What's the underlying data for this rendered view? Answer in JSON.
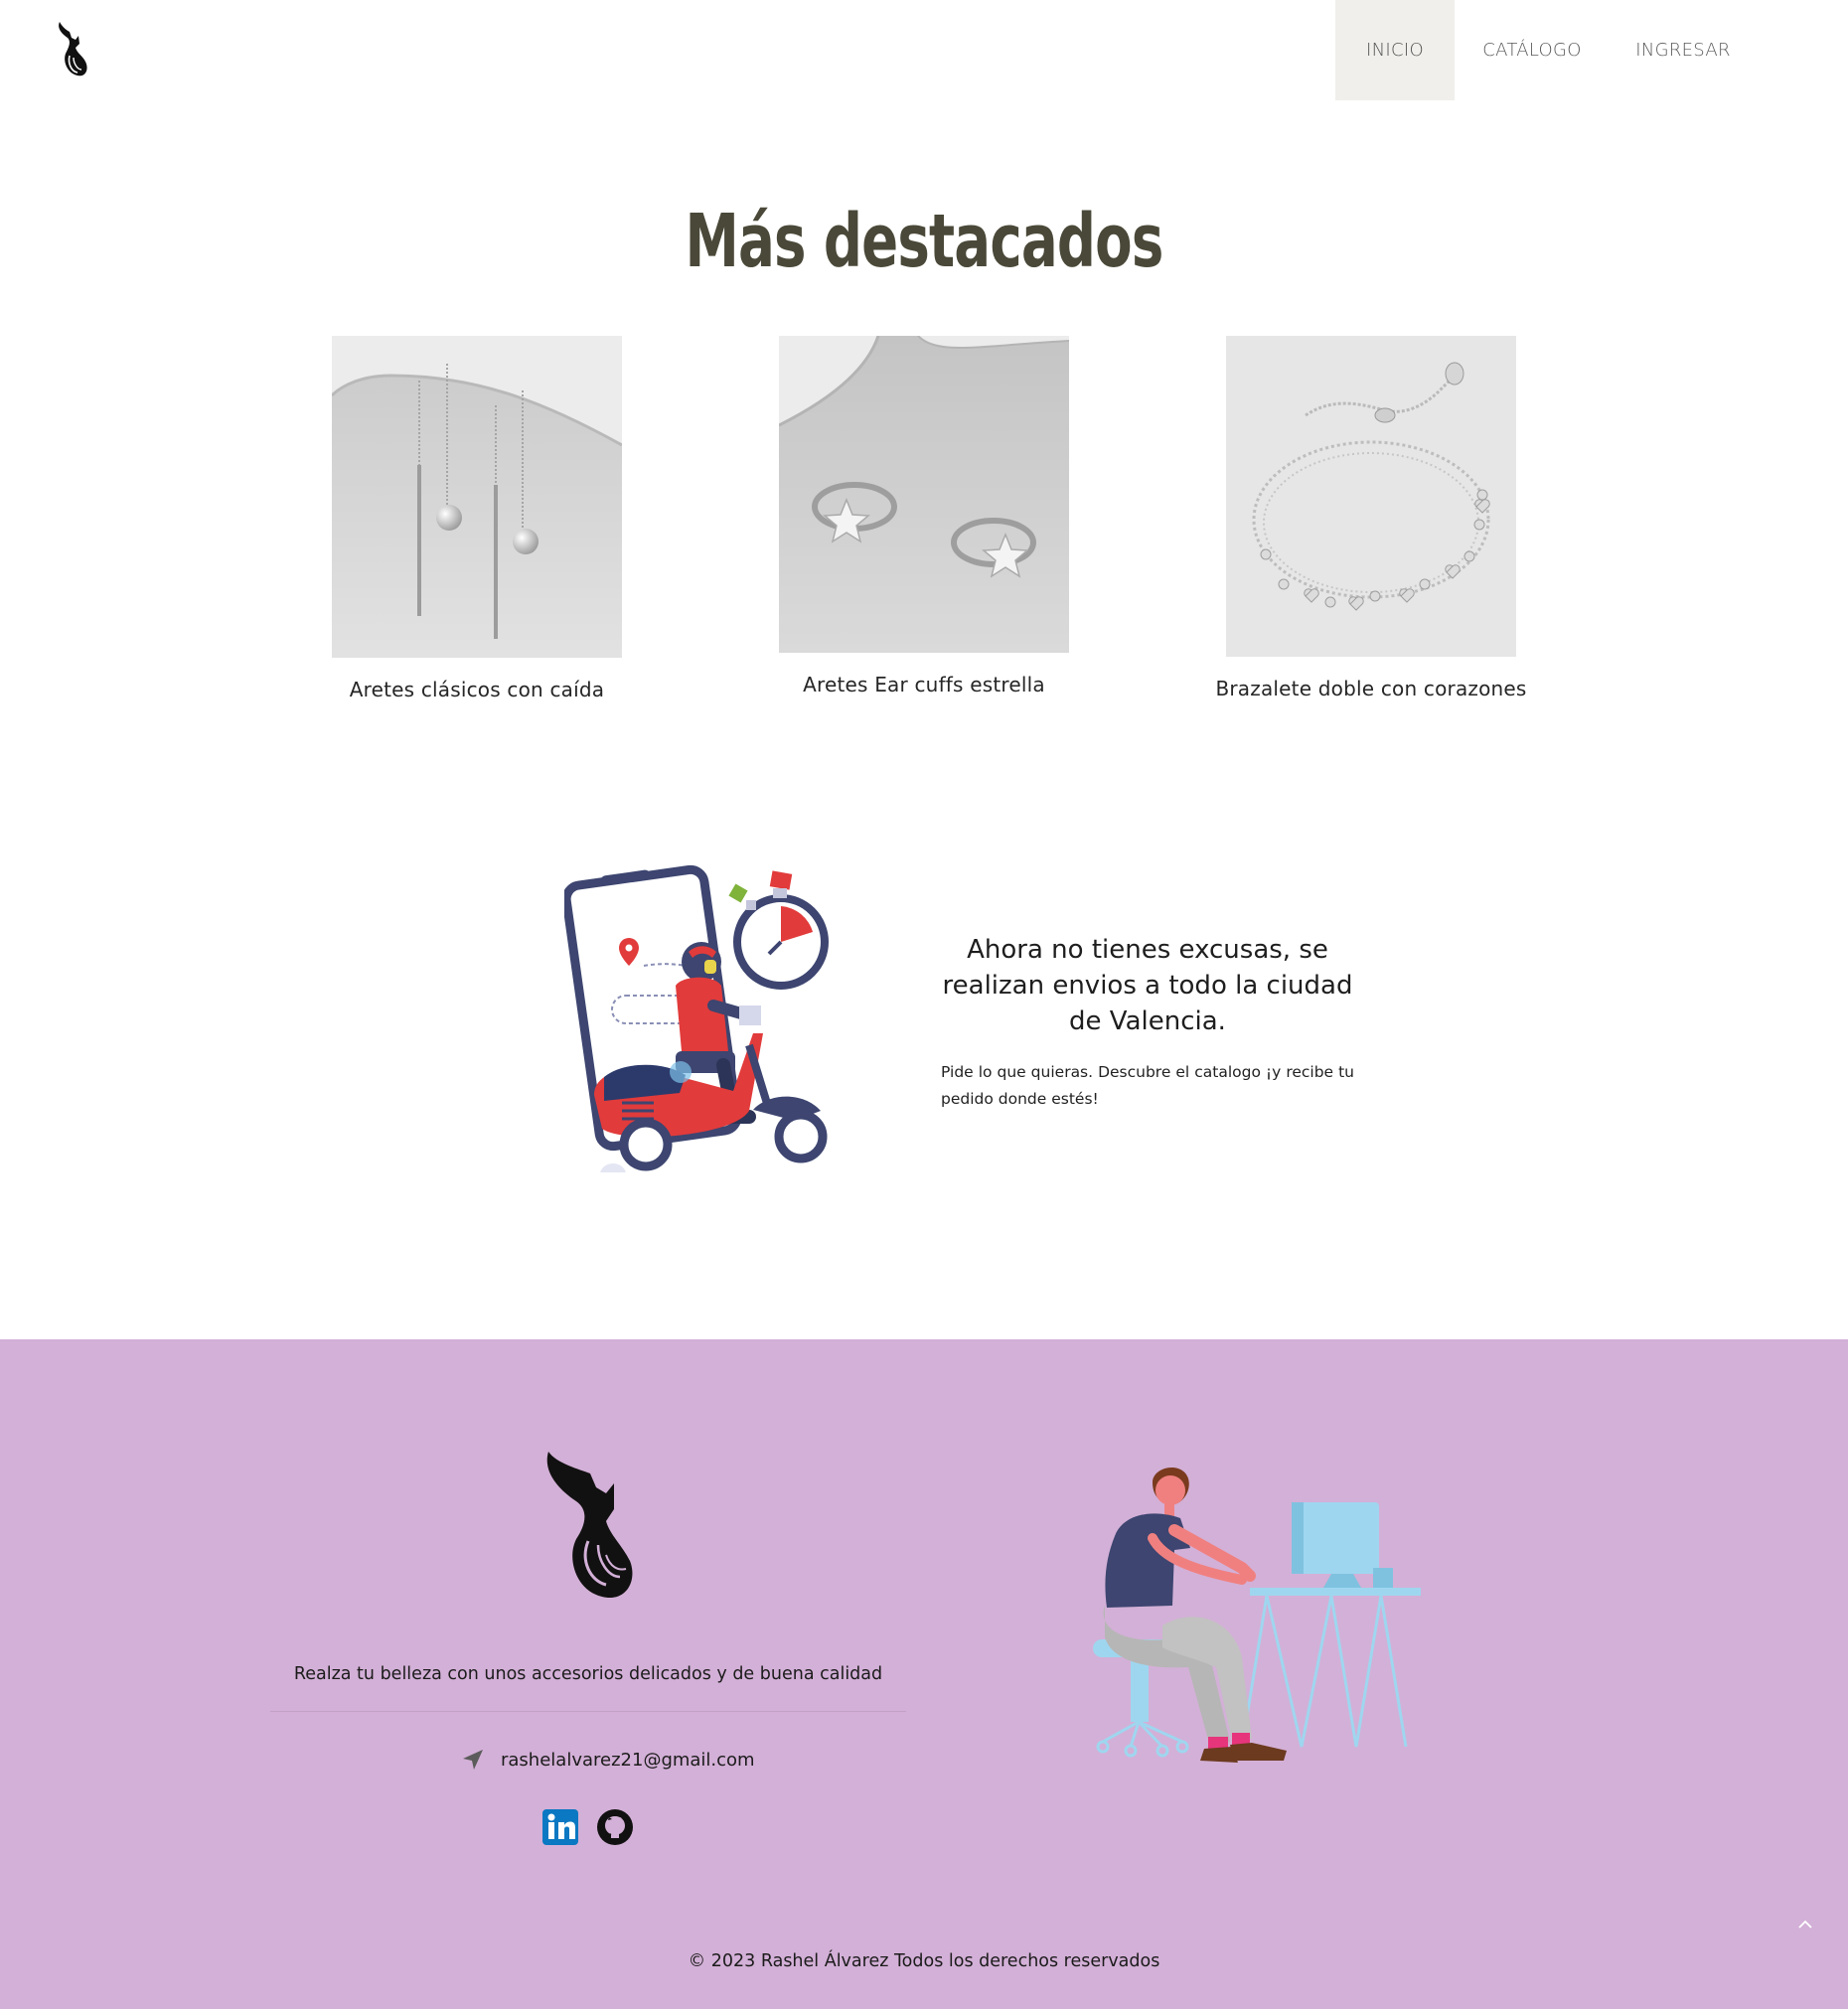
{
  "header": {
    "nav": [
      {
        "label": "INICIO",
        "active": true
      },
      {
        "label": "CATÁLOGO",
        "active": false
      },
      {
        "label": "INGRESAR",
        "active": false
      }
    ]
  },
  "featured": {
    "title": "Más destacados",
    "products": [
      {
        "name": "Aretes clásicos con caída",
        "image": "drop-earrings-photo"
      },
      {
        "name": "Aretes Ear cuffs estrella",
        "image": "star-ear-cuffs-photo"
      },
      {
        "name": "Brazalete doble con corazones",
        "image": "heart-bracelet-photo"
      }
    ]
  },
  "delivery": {
    "title": "Ahora no tienes excusas, se realizan envios a todo la ciudad de Valencia.",
    "text": "Pide lo que quieras. Descubre el catalogo ¡y recibe tu pedido donde estés!"
  },
  "footer": {
    "tagline": "Realza tu belleza con unos accesorios delicados y de buena calidad",
    "email": "rashelalvarez21@gmail.com",
    "social": [
      "linkedin-icon",
      "github-icon"
    ],
    "copyright": "© 2023 Rashel Álvarez Todos los derechos reservados",
    "background_color": "#d3b0d7"
  },
  "colors": {
    "nav_active_bg": "#f0efeb",
    "title_color": "#4a4838"
  }
}
